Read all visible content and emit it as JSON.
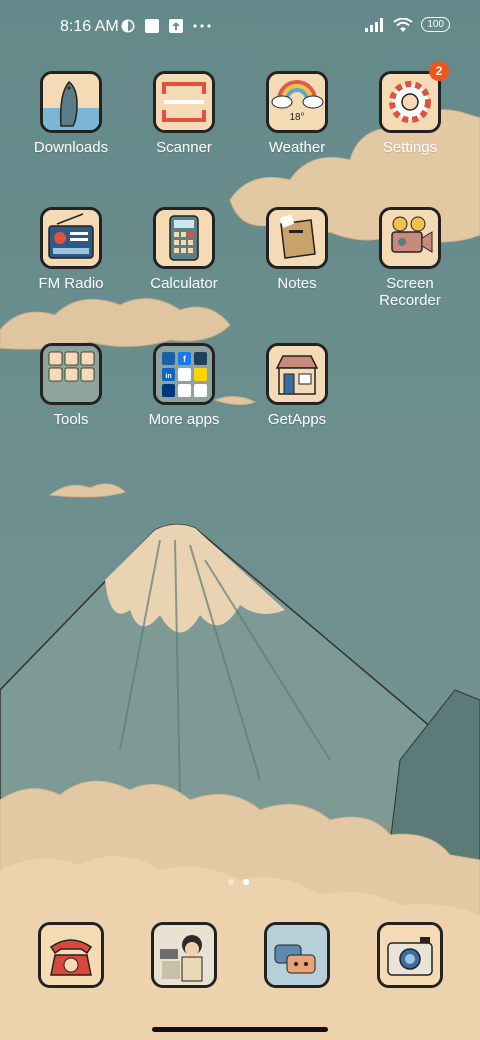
{
  "status": {
    "time": "8:16 AM",
    "battery": "100",
    "left_icons": [
      "vpn-icon",
      "square-notification-icon",
      "upload-notification-icon",
      "more-dots-icon"
    ],
    "right_icons": [
      "signal-icon",
      "wifi-icon",
      "battery-icon"
    ]
  },
  "apps": [
    {
      "label": "Downloads",
      "icon": "whale-icon"
    },
    {
      "label": "Scanner",
      "icon": "scanner-frame-icon"
    },
    {
      "label": "Weather",
      "icon": "weather-rainbow-icon",
      "temp": "18°"
    },
    {
      "label": "Settings",
      "icon": "gear-icon",
      "badge": "2"
    },
    {
      "label": "FM Radio",
      "icon": "radio-icon"
    },
    {
      "label": "Calculator",
      "icon": "calculator-icon"
    },
    {
      "label": "Notes",
      "icon": "notes-icon"
    },
    {
      "label": "Screen\nRecorder",
      "icon": "film-camera-icon"
    },
    {
      "label": "Tools",
      "icon": "folder-icon"
    },
    {
      "label": "More apps",
      "icon": "folder-icon",
      "folder_items": [
        "Walmart",
        "f",
        "amazon",
        "in",
        "Mi Credit",
        "Bookings"
      ]
    },
    {
      "label": "GetApps",
      "icon": "store-icon"
    }
  ],
  "dock": [
    {
      "name": "phone",
      "icon": "rotary-phone-icon"
    },
    {
      "name": "messaging",
      "icon": "girl-illustration-icon"
    },
    {
      "name": "messages",
      "icon": "chat-bubbles-icon"
    },
    {
      "name": "camera",
      "icon": "camera-icon"
    }
  ],
  "page": {
    "current": 2,
    "total": 2
  }
}
